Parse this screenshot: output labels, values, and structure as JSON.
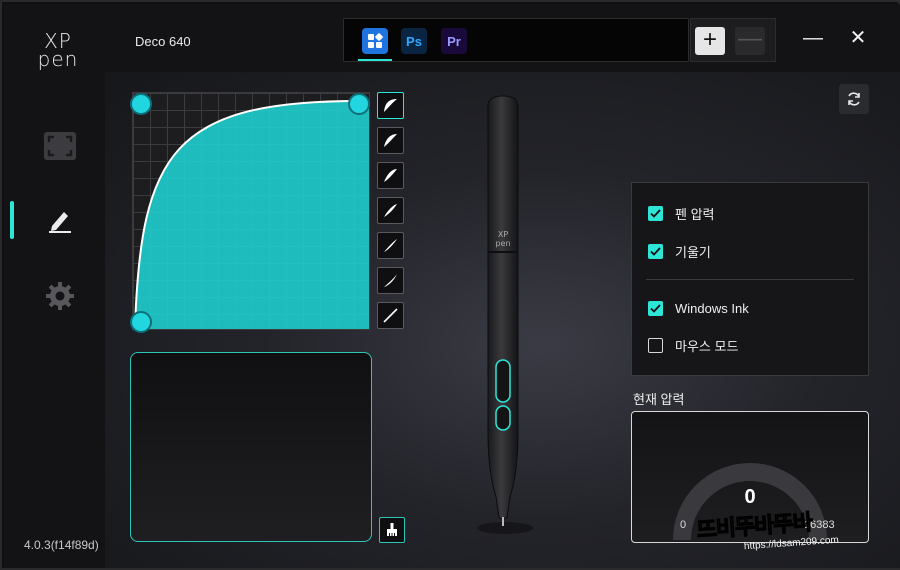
{
  "sidebar": {
    "logo_line1": "XP",
    "logo_line2": "pen",
    "items": [
      {
        "name": "work-area"
      },
      {
        "name": "pen"
      },
      {
        "name": "settings"
      }
    ],
    "version": "4.0.3(f14f89d)"
  },
  "header": {
    "device": "Deco 640",
    "apps": [
      {
        "label": "",
        "icon": "all-apps-icon"
      },
      {
        "label": "Ps"
      },
      {
        "label": "Pr"
      }
    ],
    "add_label": "+",
    "remove_label": "—",
    "minimize_label": "—",
    "close_label": "✕"
  },
  "pen_settings": {
    "options": [
      {
        "label": "펜 압력",
        "checked": true
      },
      {
        "label": "기울기",
        "checked": true
      },
      {
        "label": "Windows Ink",
        "checked": true
      },
      {
        "label": "마우스 모드",
        "checked": false
      }
    ],
    "pen_brand": {
      "line1": "XP",
      "line2": "pen"
    }
  },
  "pressure": {
    "label": "현재 압력",
    "value": "0",
    "min": "0",
    "max": "16383"
  },
  "colors": {
    "accent": "#2ee6d6",
    "curve_fill": "#1fd8d8"
  },
  "watermark": {
    "title": "뜨비뚜바뚜바",
    "url": "https://ldsam209.com"
  }
}
